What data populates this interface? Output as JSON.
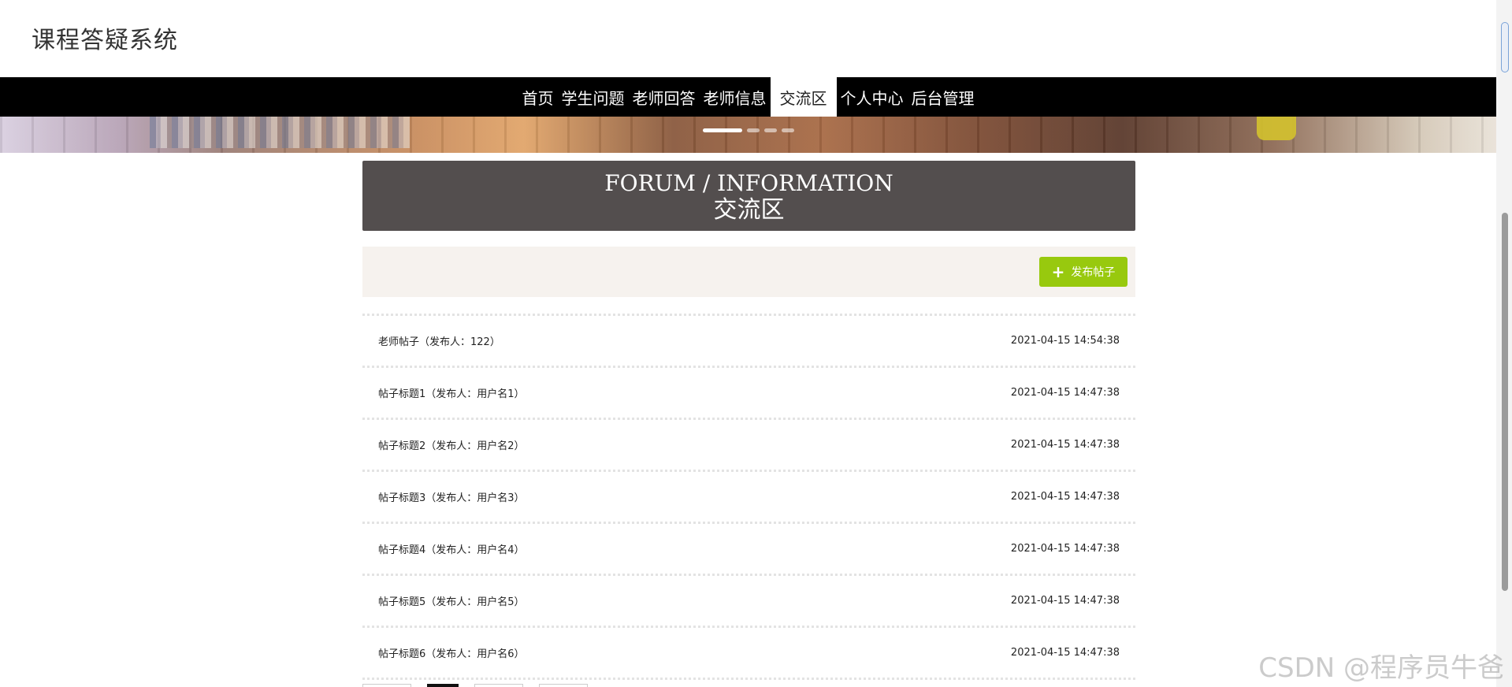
{
  "header": {
    "site_title": "课程答疑系统"
  },
  "nav": {
    "items": [
      {
        "label": "首页"
      },
      {
        "label": "学生问题"
      },
      {
        "label": "老师回答"
      },
      {
        "label": "老师信息"
      },
      {
        "label": "交流区",
        "active": true
      },
      {
        "label": "个人中心"
      },
      {
        "label": "后台管理"
      }
    ]
  },
  "banner": {
    "slide_count": 4,
    "active_slide": 1
  },
  "section": {
    "title_en": "FORUM / INFORMATION",
    "title_cn": "交流区"
  },
  "actions": {
    "publish_label": "发布帖子",
    "publish_icon": "plus-icon",
    "publish_color": "#98c90e"
  },
  "posts": [
    {
      "title": "老师帖子（发布人：122）",
      "time": "2021-04-15 14:54:38"
    },
    {
      "title": "帖子标题1（发布人：用户名1）",
      "time": "2021-04-15 14:47:38"
    },
    {
      "title": "帖子标题2（发布人：用户名2）",
      "time": "2021-04-15 14:47:38"
    },
    {
      "title": "帖子标题3（发布人：用户名3）",
      "time": "2021-04-15 14:47:38"
    },
    {
      "title": "帖子标题4（发布人：用户名4）",
      "time": "2021-04-15 14:47:38"
    },
    {
      "title": "帖子标题5（发布人：用户名5）",
      "time": "2021-04-15 14:47:38"
    },
    {
      "title": "帖子标题6（发布人：用户名6）",
      "time": "2021-04-15 14:47:38"
    }
  ],
  "watermark": "CSDN @程序员牛爸",
  "colors": {
    "nav_bg": "#000000",
    "title_bg": "#534e4e",
    "action_bg": "#f6f2ee"
  }
}
